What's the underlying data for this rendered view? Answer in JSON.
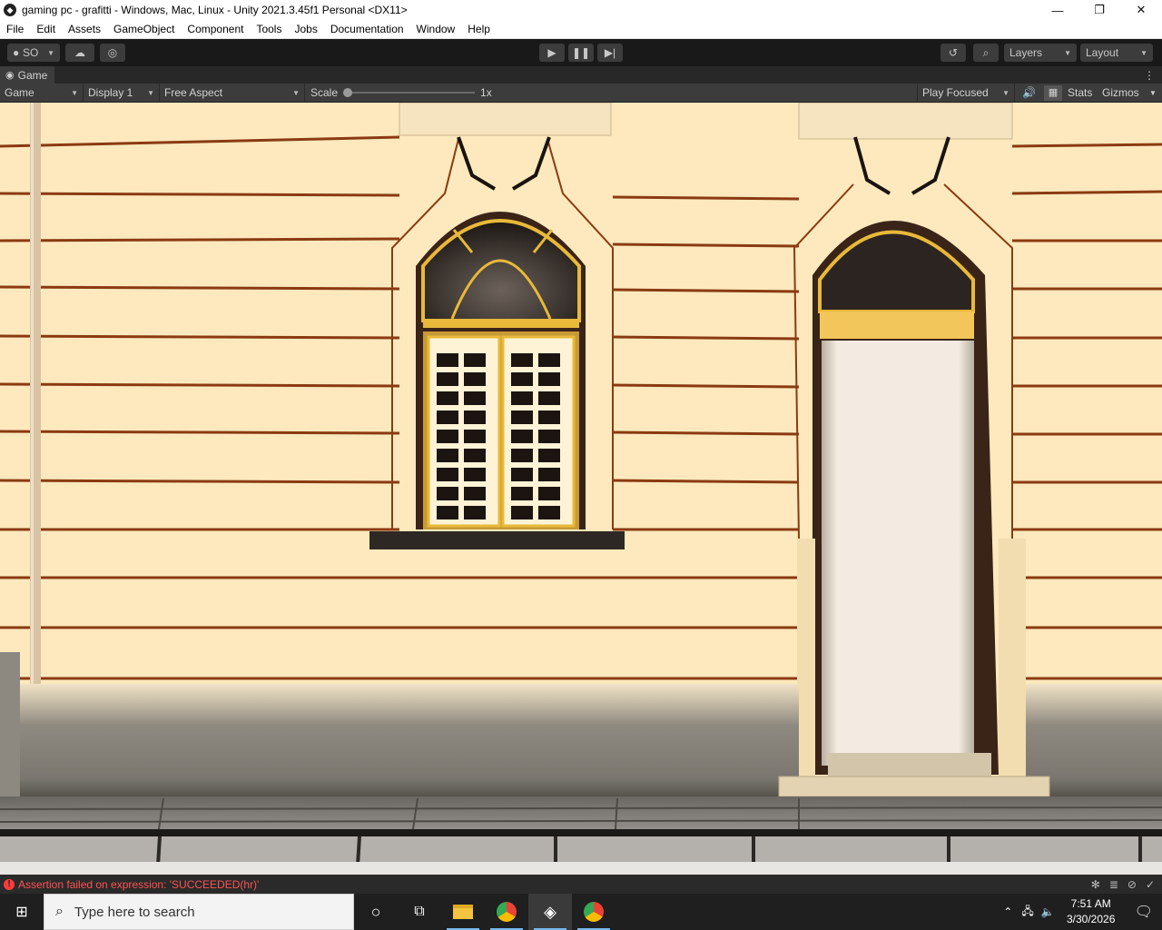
{
  "window": {
    "title": "gaming pc - grafitti - Windows, Mac, Linux - Unity 2021.3.45f1 Personal <DX11>",
    "controls": {
      "minimize": "—",
      "maximize": "❐",
      "close": "✕"
    }
  },
  "menu": [
    "File",
    "Edit",
    "Assets",
    "GameObject",
    "Component",
    "Tools",
    "Jobs",
    "Documentation",
    "Window",
    "Help"
  ],
  "toolbar": {
    "account": "SO",
    "layers": "Layers",
    "layout": "Layout"
  },
  "game_tab": {
    "label": "Game"
  },
  "game_controls": {
    "view": "Game",
    "display": "Display 1",
    "aspect": "Free Aspect",
    "scale_label": "Scale",
    "scale_value": "1x",
    "scale_fraction": 0,
    "play_mode": "Play Focused",
    "stats": "Stats",
    "gizmos": "Gizmos"
  },
  "status": {
    "error": "Assertion failed on expression: 'SUCCEEDED(hr)'"
  },
  "taskbar": {
    "search_placeholder": "Type here to search",
    "time": "7:51 AM",
    "date": "3/30/2026"
  },
  "colors": {
    "wall": "#fde9bd",
    "wall_lines": "#8a3a12",
    "frame_gold": "#e8b93a",
    "unity_dark": "#191919",
    "error_red": "#ff5252"
  }
}
